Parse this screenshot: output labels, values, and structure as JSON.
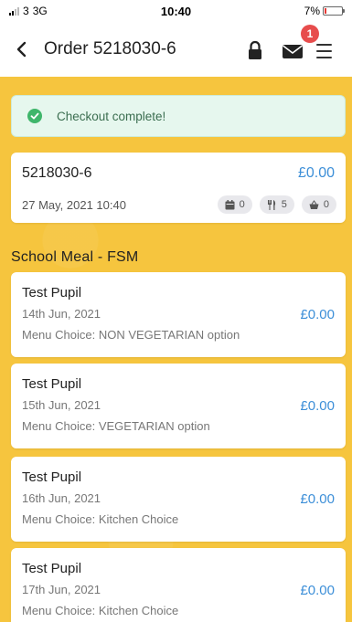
{
  "status_bar": {
    "carrier": "3",
    "network": "3G",
    "time": "10:40",
    "battery": "7%"
  },
  "nav": {
    "title": "Order 5218030-6",
    "mail_badge": "1",
    "icons": [
      "chevron-left-icon",
      "lock-icon",
      "mail-icon",
      "hamburger-menu-icon"
    ]
  },
  "alert": {
    "text": "Checkout complete!",
    "color": "#3b6e50",
    "background": "#e6f7ee"
  },
  "order": {
    "number": "5218030-6",
    "total": "£0.00",
    "date": "27 May, 2021 10:40",
    "chips": [
      {
        "icon": "calendar-icon",
        "count": "0"
      },
      {
        "icon": "cutlery-icon",
        "count": "5"
      },
      {
        "icon": "basket-icon",
        "count": "0"
      }
    ]
  },
  "section": {
    "title": "School Meal - FSM"
  },
  "meals": [
    {
      "name": "Test Pupil",
      "date": "14th Jun, 2021",
      "choice": "Menu Choice: NON VEGETARIAN option",
      "price": "£0.00"
    },
    {
      "name": "Test Pupil",
      "date": "15th Jun, 2021",
      "choice": "Menu Choice: VEGETARIAN option",
      "price": "£0.00"
    },
    {
      "name": "Test Pupil",
      "date": "16th Jun, 2021",
      "choice": "Menu Choice: Kitchen Choice",
      "price": "£0.00"
    },
    {
      "name": "Test Pupil",
      "date": "17th Jun, 2021",
      "choice": "Menu Choice: Kitchen Choice",
      "price": "£0.00"
    }
  ],
  "colors": {
    "accent": "#3d8fd8",
    "background": "#f6c53e",
    "badge": "#e74c4c"
  }
}
